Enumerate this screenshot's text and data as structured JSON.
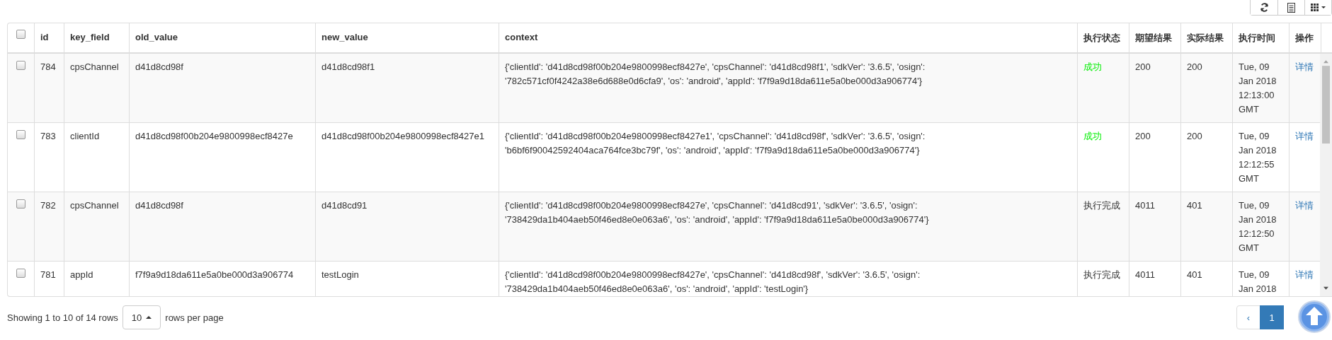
{
  "toolbar": {
    "buttons": [
      {
        "kind": "refresh"
      },
      {
        "kind": "list"
      },
      {
        "kind": "columns"
      }
    ]
  },
  "table": {
    "select_all": {
      "checked": false
    },
    "columns": [
      "id",
      "key_field",
      "old_value",
      "new_value",
      "context",
      "执行状态",
      "期望结果",
      "实际结果",
      "执行时间",
      "操作"
    ],
    "rows": [
      {
        "checked": false,
        "id": "784",
        "key_field": "cpsChannel",
        "old_value": "d41d8cd98f",
        "new_value": "d41d8cd98f1",
        "context": "{'clientId': 'd41d8cd98f00b204e9800998ecf8427e', 'cpsChannel': 'd41d8cd98f1', 'sdkVer': '3.6.5', 'osign': '782c571cf0f4242a38e6d688e0d6cfa9', 'os': 'android', 'appId': 'f7f9a9d18da611e5a0be000d3a906774'}",
        "status": {
          "text": "成功",
          "kind": "success"
        },
        "expected": "200",
        "actual": "200",
        "time": "Tue, 09 Jan 2018 12:13:00 GMT",
        "action": "详情"
      },
      {
        "checked": false,
        "id": "783",
        "key_field": "clientId",
        "old_value": "d41d8cd98f00b204e9800998ecf8427e",
        "new_value": "d41d8cd98f00b204e9800998ecf8427e1",
        "context": "{'clientId': 'd41d8cd98f00b204e9800998ecf8427e1', 'cpsChannel': 'd41d8cd98f', 'sdkVer': '3.6.5', 'osign': 'b6bf6f90042592404aca764fce3bc79f', 'os': 'android', 'appId': 'f7f9a9d18da611e5a0be000d3a906774'}",
        "status": {
          "text": "成功",
          "kind": "success"
        },
        "expected": "200",
        "actual": "200",
        "time": "Tue, 09 Jan 2018 12:12:55 GMT",
        "action": "详情"
      },
      {
        "checked": false,
        "id": "782",
        "key_field": "cpsChannel",
        "old_value": "d41d8cd98f",
        "new_value": "d41d8cd91",
        "context": "{'clientId': 'd41d8cd98f00b204e9800998ecf8427e', 'cpsChannel': 'd41d8cd91', 'sdkVer': '3.6.5', 'osign': '738429da1b404aeb50f46ed8e0e063a6', 'os': 'android', 'appId': 'f7f9a9d18da611e5a0be000d3a906774'}",
        "status": {
          "text": "执行完成",
          "kind": "done"
        },
        "expected": "4011",
        "actual": "401",
        "time": "Tue, 09 Jan 2018 12:12:50 GMT",
        "action": "详情"
      },
      {
        "checked": false,
        "id": "781",
        "key_field": "appId",
        "old_value": "f7f9a9d18da611e5a0be000d3a906774",
        "new_value": "testLogin",
        "context": "{'clientId': 'd41d8cd98f00b204e9800998ecf8427e', 'cpsChannel': 'd41d8cd98f', 'sdkVer': '3.6.5', 'osign': '738429da1b404aeb50f46ed8e0e063a6', 'os': 'android', 'appId': 'testLogin'}",
        "status": {
          "text": "执行完成",
          "kind": "done"
        },
        "expected": "4011",
        "actual": "401",
        "time": "Tue, 09 Jan 2018",
        "action": "详情"
      }
    ]
  },
  "footer": {
    "summary": "Showing 1 to 10 of 14 rows",
    "page_size": "10",
    "page_size_suffix": "rows per page"
  },
  "pagination": [
    {
      "label": "‹",
      "selected": false
    },
    {
      "label": "1",
      "selected": true
    }
  ]
}
